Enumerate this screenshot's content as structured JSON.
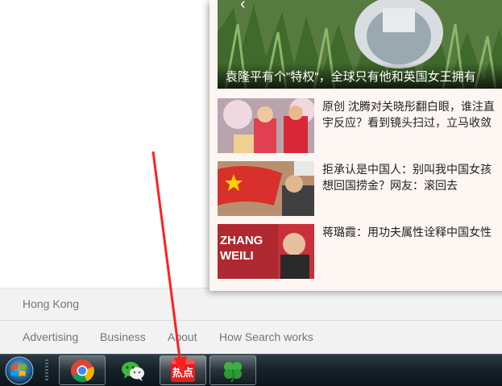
{
  "footer": {
    "country": "Hong Kong",
    "links": [
      "Advertising",
      "Business",
      "About",
      "How Search works"
    ]
  },
  "news_panel": {
    "hero": {
      "caption": "袁隆平有个\"特权\"，全球只有他和英国女王拥有"
    },
    "items": [
      {
        "title_line1": "原创 沈腾对关晓彤翻白眼，谁注直",
        "title_line2": "宇反应？看到镜头扫过，立马收敛",
        "thumb_colors": [
          "#c8a0a8",
          "#e04050",
          "#f0d090"
        ]
      },
      {
        "title_line1": "拒承认是中国人：别叫我中国女孩",
        "title_line2": "想回国捞金？网友：滚回去",
        "thumb_colors": [
          "#d83a2a",
          "#ffd000",
          "#3a3a3a"
        ]
      },
      {
        "title_line1": "蒋璐霞：用功夫属性诠释中国女性",
        "title_line2": "",
        "thumb_text": "ZHANG WEILI",
        "thumb_colors": [
          "#c8303a",
          "#ffffff",
          "#2a2a2a"
        ]
      }
    ]
  },
  "taskbar": {
    "start_icon": "windows-start-icon",
    "apps": [
      {
        "name": "chrome",
        "icon": "chrome-icon",
        "state": "open"
      },
      {
        "name": "wechat",
        "icon": "wechat-icon",
        "state": "pinned"
      },
      {
        "name": "redian",
        "icon": "redian-icon",
        "label": "热点",
        "state": "active"
      },
      {
        "name": "clover",
        "icon": "clover-icon",
        "state": "open"
      }
    ]
  },
  "annotation": {
    "arrow_color": "#ff2020"
  }
}
